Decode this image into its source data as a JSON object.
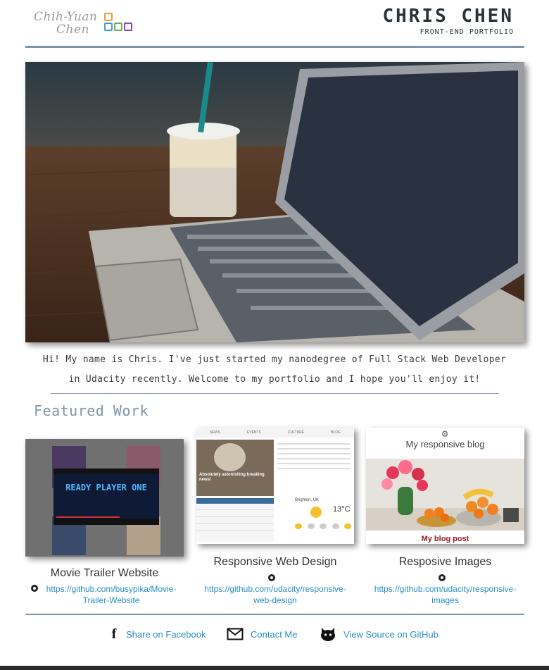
{
  "header": {
    "logo_line1": "Chih-Yuan",
    "logo_line2": "Chen",
    "name": "CHRIS CHEN",
    "subtitle": "FRONT-END PORTFOLIO"
  },
  "intro": {
    "line1": "Hi! My name is Chris. I've just started my nanodegree of Full Stack Web Developer",
    "line2": "in Udacity recently. Welcome to my portfolio and I hope you'll enjoy it!"
  },
  "featured": {
    "title": "Featured Work",
    "projects": [
      {
        "title": "Movie Trailer Website",
        "link_line1": "https://github.com/busypika/Movie-",
        "link_line2": "Trailer-Website",
        "thumb_text": "READY PLAYER ONE"
      },
      {
        "title": "Responsive Web Design",
        "link_line1": "https://github.com/udacity/responsive-",
        "link_line2": "web-design",
        "thumb_nav": [
          "NEWS",
          "EVENTS",
          "CULTURE",
          "BLOG"
        ],
        "thumb_headline": "Absolutely astonishing breaking news!",
        "thumb_location": "Brighton, UK",
        "thumb_temp": "13°C"
      },
      {
        "title": "Resposive Images",
        "link_line1": "https://github.com/udacity/responsive-",
        "link_line2": "images",
        "thumb_heading": "My responsive blog",
        "thumb_caption": "My blog post"
      }
    ]
  },
  "footer": {
    "facebook": "Share on Facebook",
    "contact": "Contact Me",
    "github": "View Source on GitHub"
  },
  "colors": {
    "accent": "#7f96a8",
    "link": "#2a8fc4",
    "text": "#333333"
  }
}
